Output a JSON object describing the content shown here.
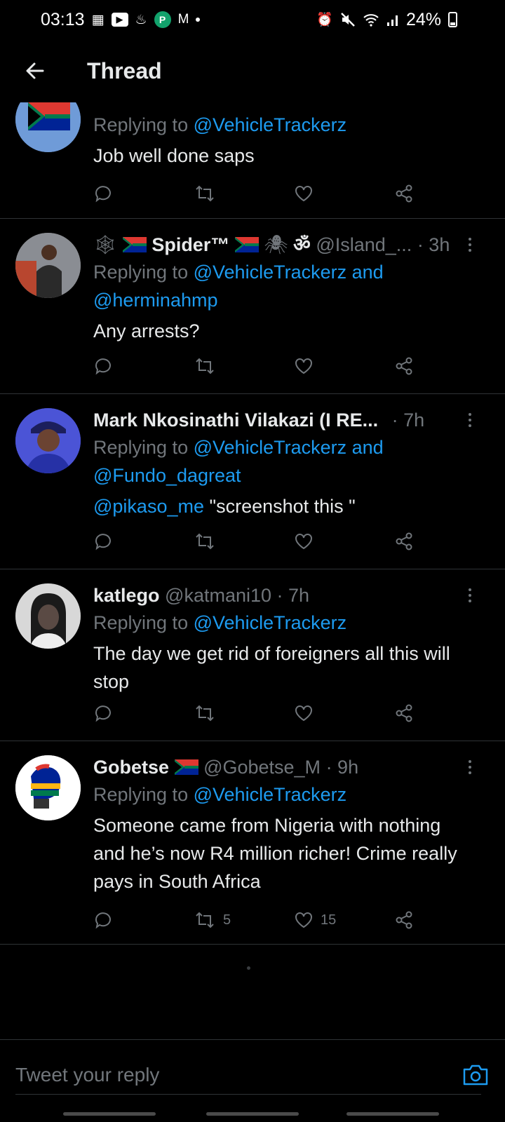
{
  "status_bar": {
    "time": "03:13",
    "battery": "24%"
  },
  "header": {
    "title": "Thread"
  },
  "tweets": [
    {
      "display_name": "",
      "handle": "",
      "time": "",
      "reply_prefix": "Replying to",
      "reply_to": "@VehicleTrackerz",
      "reply_to_2": "",
      "mention": "",
      "text": "Job well done saps",
      "retweets": "",
      "likes": ""
    },
    {
      "display_name": "Spider™",
      "handle": "@Island_...",
      "time": "· 3h",
      "reply_prefix": "Replying to",
      "reply_to": "@VehicleTrackerz and",
      "reply_to_2": "@herminahmp",
      "mention": "",
      "text": "Any arrests?",
      "retweets": "",
      "likes": ""
    },
    {
      "display_name": "Mark Nkosinathi Vilakazi (I RE...",
      "handle": "",
      "time": "· 7h",
      "reply_prefix": "Replying to",
      "reply_to": "@VehicleTrackerz and",
      "reply_to_2": "@Fundo_dagreat",
      "mention": "@pikaso_me",
      "text": "\"screenshot this \"",
      "retweets": "",
      "likes": ""
    },
    {
      "display_name": "katlego",
      "handle": "@katmani10",
      "time": "· 7h",
      "reply_prefix": "Replying to",
      "reply_to": "@VehicleTrackerz",
      "reply_to_2": "",
      "mention": "",
      "text": "The day we get rid of foreigners all this will stop",
      "retweets": "",
      "likes": ""
    },
    {
      "display_name": "Gobetse",
      "handle": "@Gobetse_M",
      "time": "· 9h",
      "reply_prefix": "Replying to",
      "reply_to": "@VehicleTrackerz",
      "reply_to_2": "",
      "mention": "",
      "text": "Someone came from Nigeria with nothing and he’s now R4 million richer! Crime really pays in South Africa",
      "retweets": "5",
      "likes": "15"
    }
  ],
  "reply_bar": {
    "placeholder": "Tweet your reply"
  },
  "icons": {
    "back": "arrow-left-icon",
    "reply": "comment-icon",
    "retweet": "retweet-icon",
    "like": "heart-icon",
    "share": "share-icon",
    "more": "more-vertical-icon",
    "camera": "camera-icon"
  },
  "colors": {
    "background": "#000000",
    "text": "#e7e9ea",
    "muted": "#71767b",
    "link": "#1d9bf0",
    "divider": "#2f3336"
  }
}
